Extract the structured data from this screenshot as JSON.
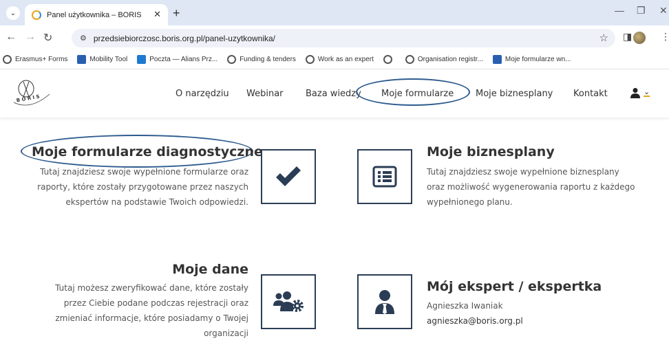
{
  "browser": {
    "tab_title": "Panel użytkownika – BORIS",
    "url": "przedsiebiorczosc.boris.org.pl/panel-uzytkownika/",
    "bookmarks": [
      {
        "label": "Erasmus+ Forms",
        "icon": "globe-icon"
      },
      {
        "label": "Mobility Tool",
        "icon": "eu-icon"
      },
      {
        "label": "Poczta — Alians Prz...",
        "icon": "outlook-icon"
      },
      {
        "label": "Funding & tenders",
        "icon": "globe-icon"
      },
      {
        "label": "Work as an expert",
        "icon": "globe-icon"
      },
      {
        "label": "",
        "icon": "globe-icon"
      },
      {
        "label": "Organisation registr...",
        "icon": "globe-icon"
      },
      {
        "label": "Moje formularze wn...",
        "icon": "eu-icon"
      }
    ]
  },
  "site": {
    "nav": {
      "o_narzedziu": "O narzędziu",
      "webinar": "Webinar",
      "baza_wiedzy": "Baza wiedzy",
      "moje_formularze": "Moje formularze",
      "moje_biznesplany": "Moje biznesplany",
      "kontakt": "Kontakt"
    },
    "logo_text": "B O R I S"
  },
  "cards": {
    "formularze": {
      "title": "Moje formularze diagnostyczne",
      "desc_1": "Tutaj znajdziesz swoje wypełnione formularze oraz",
      "desc_2": "raporty, które zostały przygotowane przez naszych",
      "desc_3": "ekspertów na podstawie Twoich odpowiedzi.",
      "icon": "check-icon"
    },
    "biznesplany": {
      "title": "Moje biznesplany",
      "desc_1": "Tutaj znajdziesz swoje wypełnione biznesplany",
      "desc_2": "oraz możliwość wygenerowania raportu z każdego",
      "desc_3": "wypełnionego planu.",
      "icon": "list-icon"
    },
    "dane": {
      "title": "Moje dane",
      "desc_1": "Tutaj możesz zweryfikować dane, które zostały",
      "desc_2": "przez Ciebie podane podczas rejestracji oraz",
      "desc_3": "zmieniać informacje, które posiadamy o Twojej",
      "desc_4": "organizacji",
      "icon": "users-gear-icon"
    },
    "ekspert": {
      "title": "Mój ekspert / ekspertka",
      "name": "Agnieszka Iwaniak",
      "email": "agnieszka@boris.org.pl",
      "icon": "user-tie-icon"
    }
  },
  "colors": {
    "accent_navy": "#2b3d55",
    "annotation": "#2d5a8e",
    "user_underline": "#e8a31d"
  }
}
